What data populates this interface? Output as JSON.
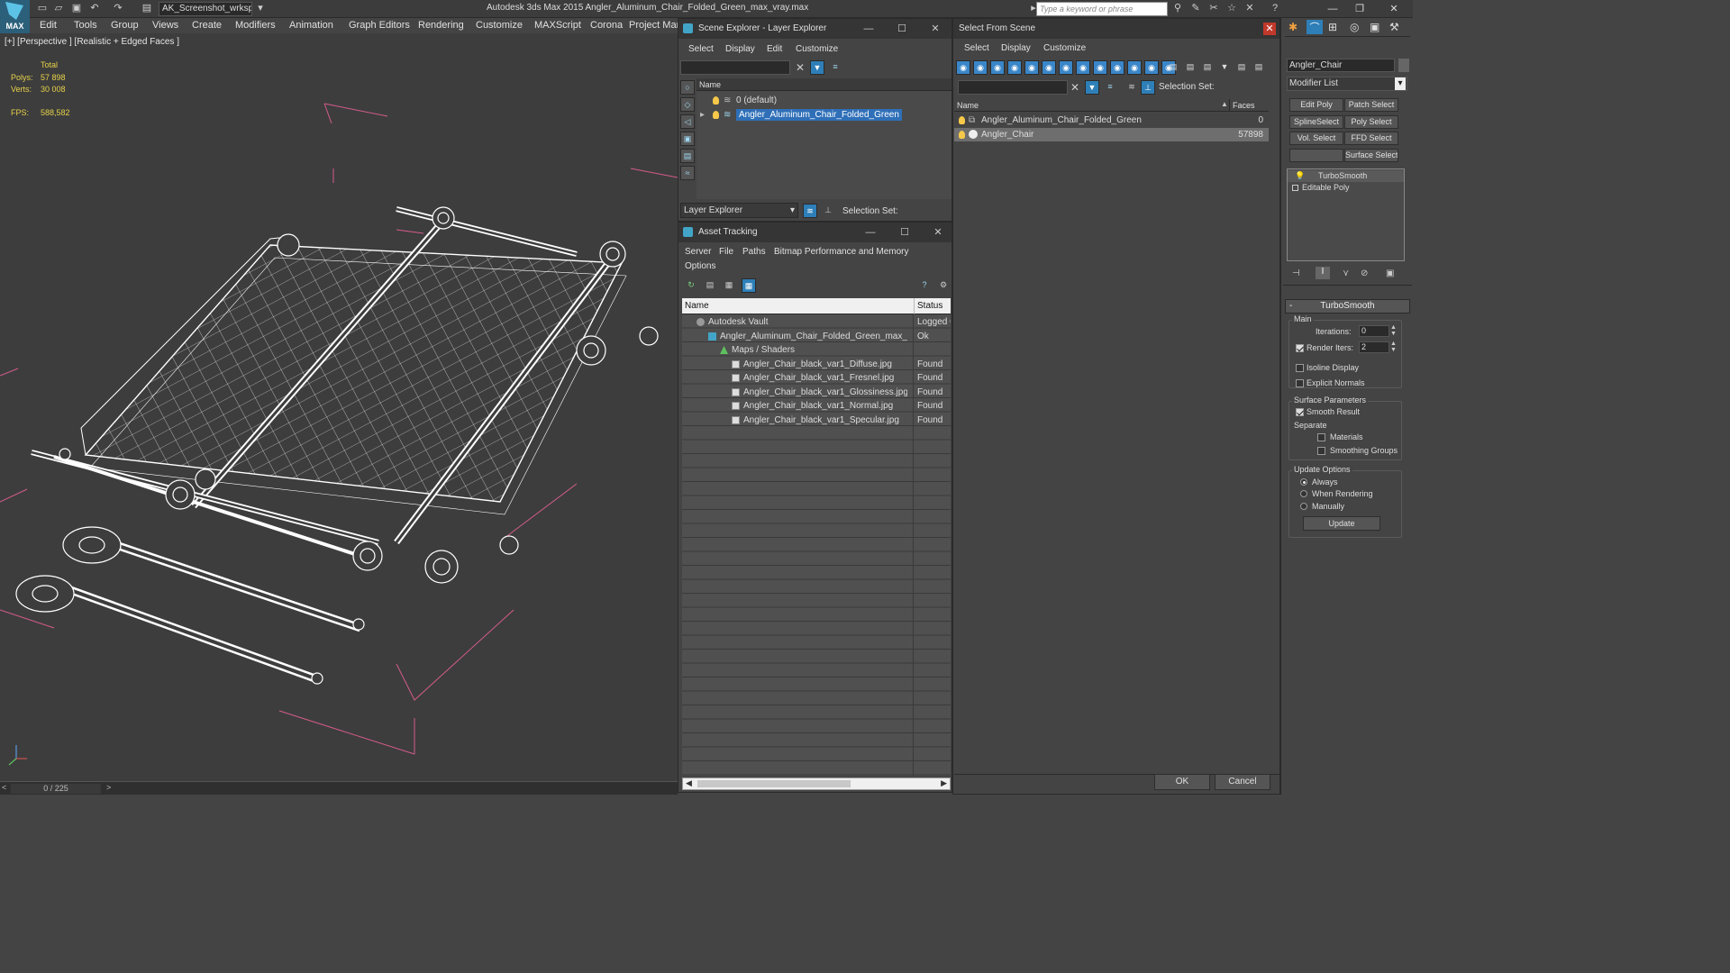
{
  "app": {
    "logo_label": "MAX",
    "workspace": "AK_Screenshot_wrksp",
    "title": "Autodesk 3ds Max  2015    Angler_Aluminum_Chair_Folded_Green_max_vray.max",
    "search_placeholder": "Type a keyword or phrase"
  },
  "menu": [
    "Edit",
    "Tools",
    "Group",
    "Views",
    "Create",
    "Modifiers",
    "Animation",
    "Graph Editors",
    "Rendering",
    "Customize",
    "MAXScript",
    "Corona",
    "Project Man"
  ],
  "viewport": {
    "label": "[+] [Perspective ] [Realistic + Edged Faces ]",
    "stats": {
      "total_label": "Total",
      "polys_label": "Polys:",
      "polys_value": "57 898",
      "verts_label": "Verts:",
      "verts_value": "30 008",
      "fps_label": "FPS:",
      "fps_value": "588,582"
    },
    "timeline": {
      "position": "0 / 225",
      "prev": "<",
      "next": ">"
    }
  },
  "scene_explorer": {
    "title": "Scene Explorer - Layer Explorer",
    "menu": [
      "Select",
      "Display",
      "Edit",
      "Customize"
    ],
    "col_name": "Name",
    "layers": [
      {
        "name": "0 (default)",
        "selected": false
      },
      {
        "name": "Angler_Aluminum_Chair_Folded_Green",
        "selected": true
      }
    ],
    "footer_dropdown": "Layer Explorer",
    "selection_set_label": "Selection Set:"
  },
  "asset_tracking": {
    "title": "Asset Tracking",
    "menu": [
      "Server",
      "File",
      "Paths",
      "Bitmap Performance and Memory"
    ],
    "menu_row2": "Options",
    "col_name": "Name",
    "col_status": "Status",
    "rows": [
      {
        "name": "Autodesk Vault",
        "status": "Logged O",
        "indent": 1
      },
      {
        "name": "Angler_Aluminum_Chair_Folded_Green_max_...",
        "status": "Ok",
        "indent": 2
      },
      {
        "name": "Maps / Shaders",
        "status": "",
        "indent": 3
      },
      {
        "name": "Angler_Chair_black_var1_Diffuse.jpg",
        "status": "Found",
        "indent": 4
      },
      {
        "name": "Angler_Chair_black_var1_Fresnel.jpg",
        "status": "Found",
        "indent": 4
      },
      {
        "name": "Angler_Chair_black_var1_Glossiness.jpg",
        "status": "Found",
        "indent": 4
      },
      {
        "name": "Angler_Chair_black_var1_Normal.jpg",
        "status": "Found",
        "indent": 4
      },
      {
        "name": "Angler_Chair_black_var1_Specular.jpg",
        "status": "Found",
        "indent": 4
      }
    ]
  },
  "select_from_scene": {
    "title": "Select From Scene",
    "menu": [
      "Select",
      "Display",
      "Customize"
    ],
    "selection_set_label": "Selection Set:",
    "col_name": "Name",
    "col_faces": "Faces",
    "rows": [
      {
        "name": "Angler_Aluminum_Chair_Folded_Green",
        "faces": "0",
        "selected": false
      },
      {
        "name": "Angler_Chair",
        "faces": "57898",
        "selected": true
      }
    ],
    "ok": "OK",
    "cancel": "Cancel"
  },
  "command_panel": {
    "object_name": "Angler_Chair",
    "modifier_list": "Modifier List",
    "buttons": [
      "Edit Poly",
      "Patch Select",
      "SplineSelect",
      "Poly Select",
      "Vol. Select",
      "FFD Select",
      "",
      "Surface Select"
    ],
    "stack": [
      "TurboSmooth",
      "Editable Poly"
    ],
    "rollout_title": "TurboSmooth",
    "main_label": "Main",
    "iterations_label": "Iterations:",
    "iterations_value": "0",
    "render_iters_label": "Render Iters:",
    "render_iters_value": "2",
    "isoline_label": "Isoline Display",
    "explicit_normals_label": "Explicit Normals",
    "surface_params_label": "Surface Parameters",
    "smooth_result_label": "Smooth Result",
    "separate_label": "Separate",
    "materials_label": "Materials",
    "smoothing_groups_label": "Smoothing Groups",
    "update_options_label": "Update Options",
    "always_label": "Always",
    "when_rendering_label": "When Rendering",
    "manually_label": "Manually",
    "update_button": "Update"
  },
  "colors": {
    "accent": "#2e7fb8",
    "stat_yellow": "#e8d24a",
    "wire": "#ffffff",
    "viewport_bg": "#3d3d3d",
    "grid_pink": "#d45c8a"
  }
}
